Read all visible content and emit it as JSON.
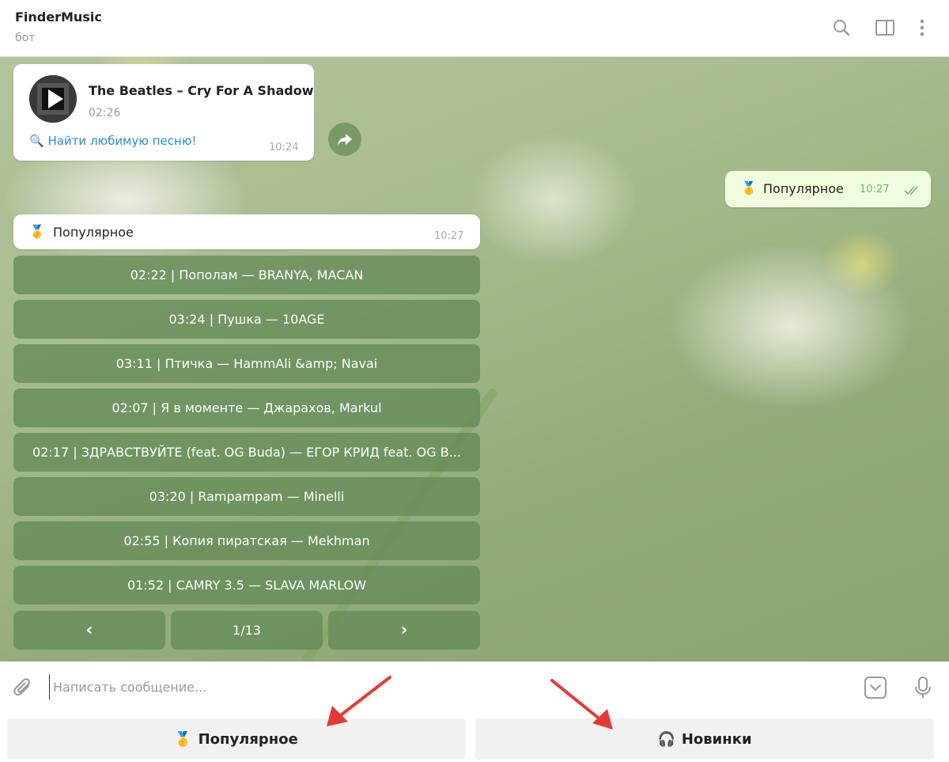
{
  "header": {
    "title": "FinderMusic",
    "status": "бот"
  },
  "messages": {
    "audio": {
      "title": "The Beatles – Cry For A Shadow",
      "duration": "02:26",
      "link_emoji": "🔍",
      "link_text": "Найти любимую песню!",
      "time": "10:24"
    },
    "outgoing": {
      "emoji": "🥇",
      "text": "Популярное",
      "time": "10:27"
    },
    "incoming": {
      "emoji": "🥇",
      "text": "Популярное",
      "time": "10:27"
    }
  },
  "keyboard": {
    "tracks": [
      "02:22 | Пополам — BRANYA, MACAN",
      "03:24 | Пушка — 10AGE",
      "03:11 | Птичка — HammAli &amp; Navai",
      "02:07 | Я в моменте — Джарахов, Markul",
      "02:17 | ЗДРАВСТВУЙТЕ (feat. OG Buda) — ЕГОР КРИД feat. OG B...",
      "03:20 | Rampampam — Minelli",
      "02:55 | Копия пиратская — Mekhman",
      "01:52 | CAMRY 3.5 — SLAVA MARLOW"
    ],
    "prev": "‹",
    "page": "1/13",
    "next": "›"
  },
  "input": {
    "placeholder": "Написать сообщение..."
  },
  "reply_keyboard": {
    "popular_emoji": "🥇",
    "popular": "Популярное",
    "new_emoji": "🎧",
    "new": "Новинки"
  },
  "colors": {
    "link": "#2b8bd3",
    "keyboard_button": "#648a58",
    "outgoing_bubble": "#effdde",
    "arrow": "#e53935"
  },
  "icons": {
    "header": [
      "search-icon",
      "sidebar-toggle-icon",
      "more-vertical-icon"
    ],
    "input": [
      "paperclip-icon",
      "keyboard-toggle-icon",
      "microphone-icon"
    ]
  }
}
